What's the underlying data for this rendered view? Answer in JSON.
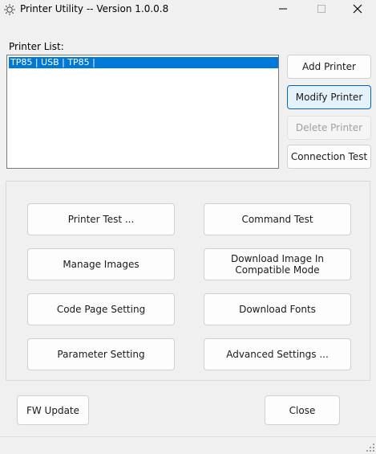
{
  "window": {
    "title": "Printer Utility -- Version 1.0.0.8"
  },
  "printer_list": {
    "label": "Printer List:",
    "items": [
      "TP85 | USB | TP85 |"
    ],
    "selected_index": 0
  },
  "side_buttons": {
    "add": "Add Printer",
    "modify": "Modify Printer",
    "delete": "Delete Printer",
    "connection_test": "Connection Test"
  },
  "function_buttons": {
    "printer_test": "Printer Test ...",
    "command_test": "Command Test",
    "manage_images": "Manage Images",
    "download_image_line1": "Download Image In",
    "download_image_line2": "Compatible Mode",
    "code_page": "Code Page Setting",
    "download_fonts": "Download Fonts",
    "parameter_setting": "Parameter Setting",
    "advanced_settings": "Advanced Settings ..."
  },
  "bottom_buttons": {
    "fw_update": "FW Update",
    "close": "Close"
  },
  "colors": {
    "selection": "#0078d7",
    "primary_button_bg": "#e5f1fb",
    "primary_button_border": "#0067c0"
  },
  "icons": {
    "app": "gear-icon",
    "minimize": "minimize-icon",
    "maximize": "maximize-icon",
    "close": "close-icon"
  }
}
